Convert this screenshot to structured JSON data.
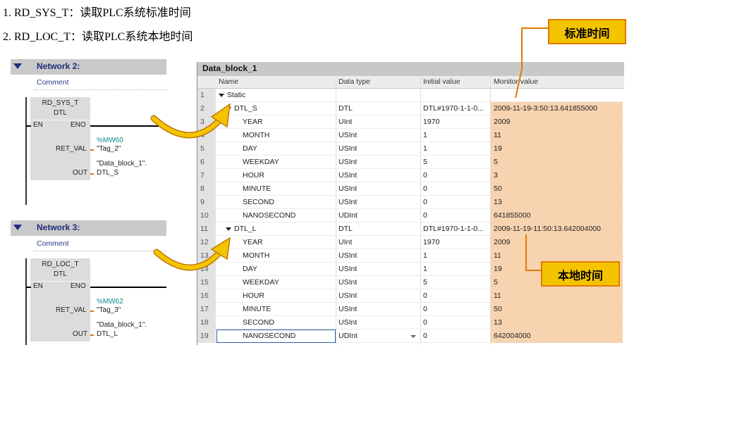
{
  "headings": [
    "1. RD_SYS_T：读取PLC系统标准时间",
    "2. RD_LOC_T：读取PLC系统本地时间"
  ],
  "networks": [
    {
      "title": "Network 2:",
      "comment": "Comment",
      "block_name": "RD_SYS_T",
      "block_type": "DTL",
      "en_label": "EN",
      "eno_label": "ENO",
      "ret_val_label": "RET_VAL",
      "out_label": "OUT",
      "ret_addr": "%MW60",
      "ret_tag": "\"Tag_2\"",
      "out_db": "\"Data_block_1\".",
      "out_member": "DTL_S"
    },
    {
      "title": "Network 3:",
      "comment": "Comment",
      "block_name": "RD_LOC_T",
      "block_type": "DTL",
      "en_label": "EN",
      "eno_label": "ENO",
      "ret_val_label": "RET_VAL",
      "out_label": "OUT",
      "ret_addr": "%MW62",
      "ret_tag": "\"Tag_3\"",
      "out_db": "\"Data_block_1\".",
      "out_member": "DTL_L"
    }
  ],
  "data_block": {
    "title": "Data_block_1",
    "columns": [
      "Name",
      "Data type",
      "Initial value",
      "Monitor value"
    ],
    "rows": [
      {
        "num": "1",
        "name": "Static",
        "type": "",
        "init": "",
        "monitor": "",
        "level": 0,
        "expanded": true
      },
      {
        "num": "2",
        "name": "DTL_S",
        "type": "DTL",
        "init": "DTL#1970-1-1-0...",
        "monitor": "2009-11-19-3:50:13.641855000",
        "level": 1,
        "expanded": true
      },
      {
        "num": "3",
        "name": "YEAR",
        "type": "UInt",
        "init": "1970",
        "monitor": "2009",
        "level": 2
      },
      {
        "num": "4",
        "name": "MONTH",
        "type": "USInt",
        "init": "1",
        "monitor": "11",
        "level": 2
      },
      {
        "num": "5",
        "name": "DAY",
        "type": "USInt",
        "init": "1",
        "monitor": "19",
        "level": 2
      },
      {
        "num": "6",
        "name": "WEEKDAY",
        "type": "USInt",
        "init": "5",
        "monitor": "5",
        "level": 2
      },
      {
        "num": "7",
        "name": "HOUR",
        "type": "USInt",
        "init": "0",
        "monitor": "3",
        "level": 2
      },
      {
        "num": "8",
        "name": "MINUTE",
        "type": "USInt",
        "init": "0",
        "monitor": "50",
        "level": 2
      },
      {
        "num": "9",
        "name": "SECOND",
        "type": "USInt",
        "init": "0",
        "monitor": "13",
        "level": 2
      },
      {
        "num": "10",
        "name": "NANOSECOND",
        "type": "UDInt",
        "init": "0",
        "monitor": "641855000",
        "level": 2
      },
      {
        "num": "11",
        "name": "DTL_L",
        "type": "DTL",
        "init": "DTL#1970-1-1-0...",
        "monitor": "2009-11-19-11:50:13.642004000",
        "level": 1,
        "expanded": true
      },
      {
        "num": "12",
        "name": "YEAR",
        "type": "UInt",
        "init": "1970",
        "monitor": "2009",
        "level": 2
      },
      {
        "num": "13",
        "name": "MONTH",
        "type": "USInt",
        "init": "1",
        "monitor": "11",
        "level": 2
      },
      {
        "num": "14",
        "name": "DAY",
        "type": "USInt",
        "init": "1",
        "monitor": "19",
        "level": 2
      },
      {
        "num": "15",
        "name": "WEEKDAY",
        "type": "USInt",
        "init": "5",
        "monitor": "5",
        "level": 2
      },
      {
        "num": "16",
        "name": "HOUR",
        "type": "USInt",
        "init": "0",
        "monitor": "11",
        "level": 2
      },
      {
        "num": "17",
        "name": "MINUTE",
        "type": "USInt",
        "init": "0",
        "monitor": "50",
        "level": 2
      },
      {
        "num": "18",
        "name": "SECOND",
        "type": "USInt",
        "init": "0",
        "monitor": "13",
        "level": 2
      },
      {
        "num": "19",
        "name": "NANOSECOND",
        "type": "UDInt",
        "init": "0",
        "monitor": "642004000",
        "level": 2,
        "selected": true
      }
    ]
  },
  "callouts": {
    "standard_time": "标准时间",
    "local_time": "本地时间"
  },
  "colors": {
    "network_title": "#1f2a7a",
    "monitor_bg": "#f7d3b0",
    "callout_fill": "#f5c400",
    "callout_border": "#e07a00",
    "tag_address": "#0a8a8a",
    "arrow_fill": "#f5c400"
  }
}
